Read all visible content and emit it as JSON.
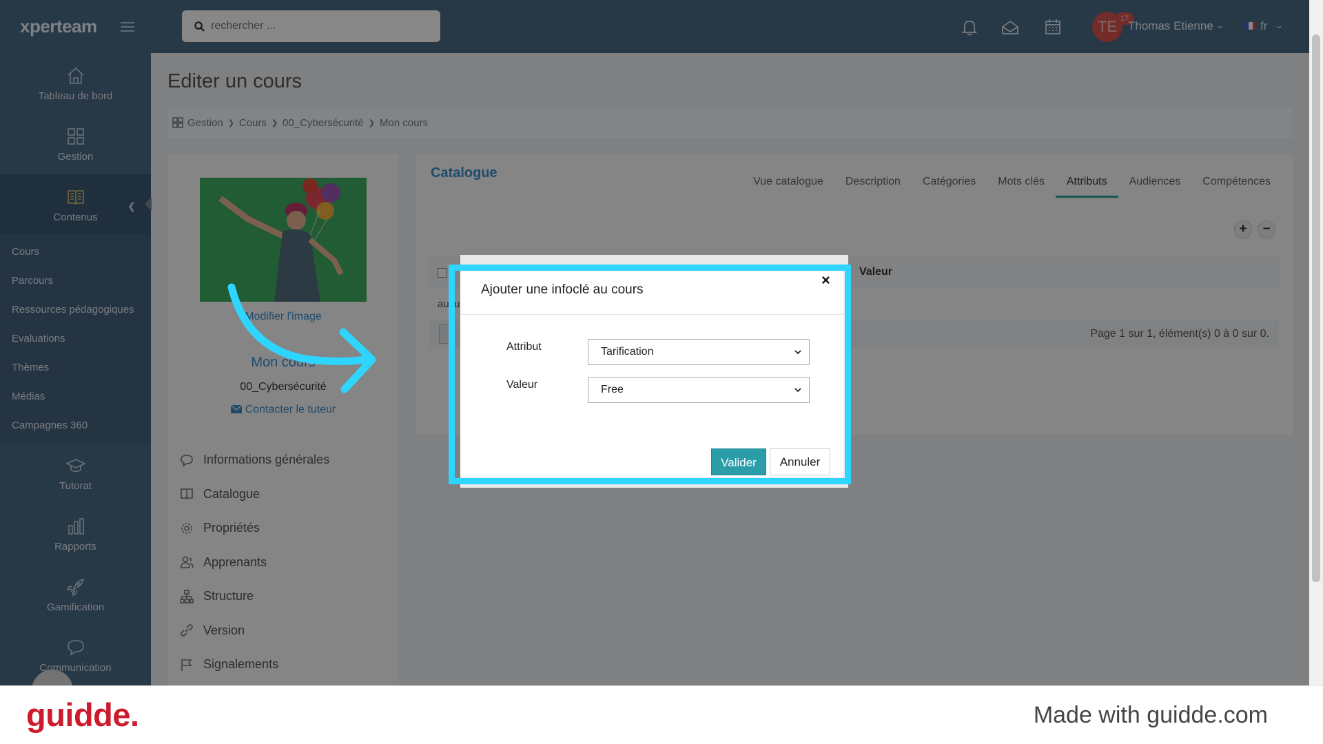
{
  "sidebar": {
    "logo": "xperteam",
    "nav": [
      {
        "label": "Tableau de bord",
        "icon": "home-icon"
      },
      {
        "label": "Gestion",
        "icon": "grid-icon"
      },
      {
        "label": "Contenus",
        "icon": "book-icon"
      }
    ],
    "submenu": [
      "Cours",
      "Parcours",
      "Ressources pédagogiques",
      "Evaluations",
      "Thèmes",
      "Médias",
      "Campagnes 360"
    ],
    "nav_bottom": [
      {
        "label": "Tutorat",
        "icon": "graduation-cap-icon"
      },
      {
        "label": "Rapports",
        "icon": "bar-chart-icon"
      },
      {
        "label": "Gamification",
        "icon": "rocket-icon"
      },
      {
        "label": "Communication",
        "icon": "chat-icon"
      }
    ]
  },
  "topbar": {
    "search_placeholder": "rechercher ...",
    "notifications_count": "17",
    "user_initials": "TE",
    "user_name": "Thomas Etienne",
    "language": "fr"
  },
  "page": {
    "title": "Editer un cours",
    "breadcrumb": [
      "Gestion",
      "Cours",
      "00_Cybersécurité",
      "Mon cours"
    ]
  },
  "course": {
    "modify_image": "Modifier l'image",
    "name": "Mon cours",
    "category": "00_Cybersécurité",
    "contact": "Contacter le tuteur",
    "menu": [
      {
        "label": "Informations générales",
        "icon": "comment-icon"
      },
      {
        "label": "Catalogue",
        "icon": "book-icon"
      },
      {
        "label": "Propriétés",
        "icon": "gear-icon"
      },
      {
        "label": "Apprenants",
        "icon": "users-icon"
      },
      {
        "label": "Structure",
        "icon": "sitemap-icon"
      },
      {
        "label": "Version",
        "icon": "link-icon"
      },
      {
        "label": "Signalements",
        "icon": "flag-icon"
      }
    ]
  },
  "catalog": {
    "title": "Catalogue",
    "tabs": [
      "Vue catalogue",
      "Description",
      "Catégories",
      "Mots clés",
      "Attributs",
      "Audiences",
      "Compétences"
    ],
    "active_tab": "Attributs",
    "column_value": "Valeur",
    "empty_row": "aucun",
    "pagination": "Page 1 sur 1, élément(s) 0 à 0 sur 0."
  },
  "modal": {
    "title": "Ajouter une infoclé au cours",
    "close": "×",
    "attribute_label": "Attribut",
    "attribute_value": "Tarification",
    "value_label": "Valeur",
    "value_value": "Free",
    "submit": "Valider",
    "cancel": "Annuler"
  },
  "footer": {
    "logo": "guidde.",
    "made_with": "Made with guidde.com"
  },
  "colors": {
    "sidebar": "#4a6b87",
    "accent": "#2a9da9",
    "highlight": "#2ed5ff",
    "brand_red": "#cc1b2c"
  }
}
